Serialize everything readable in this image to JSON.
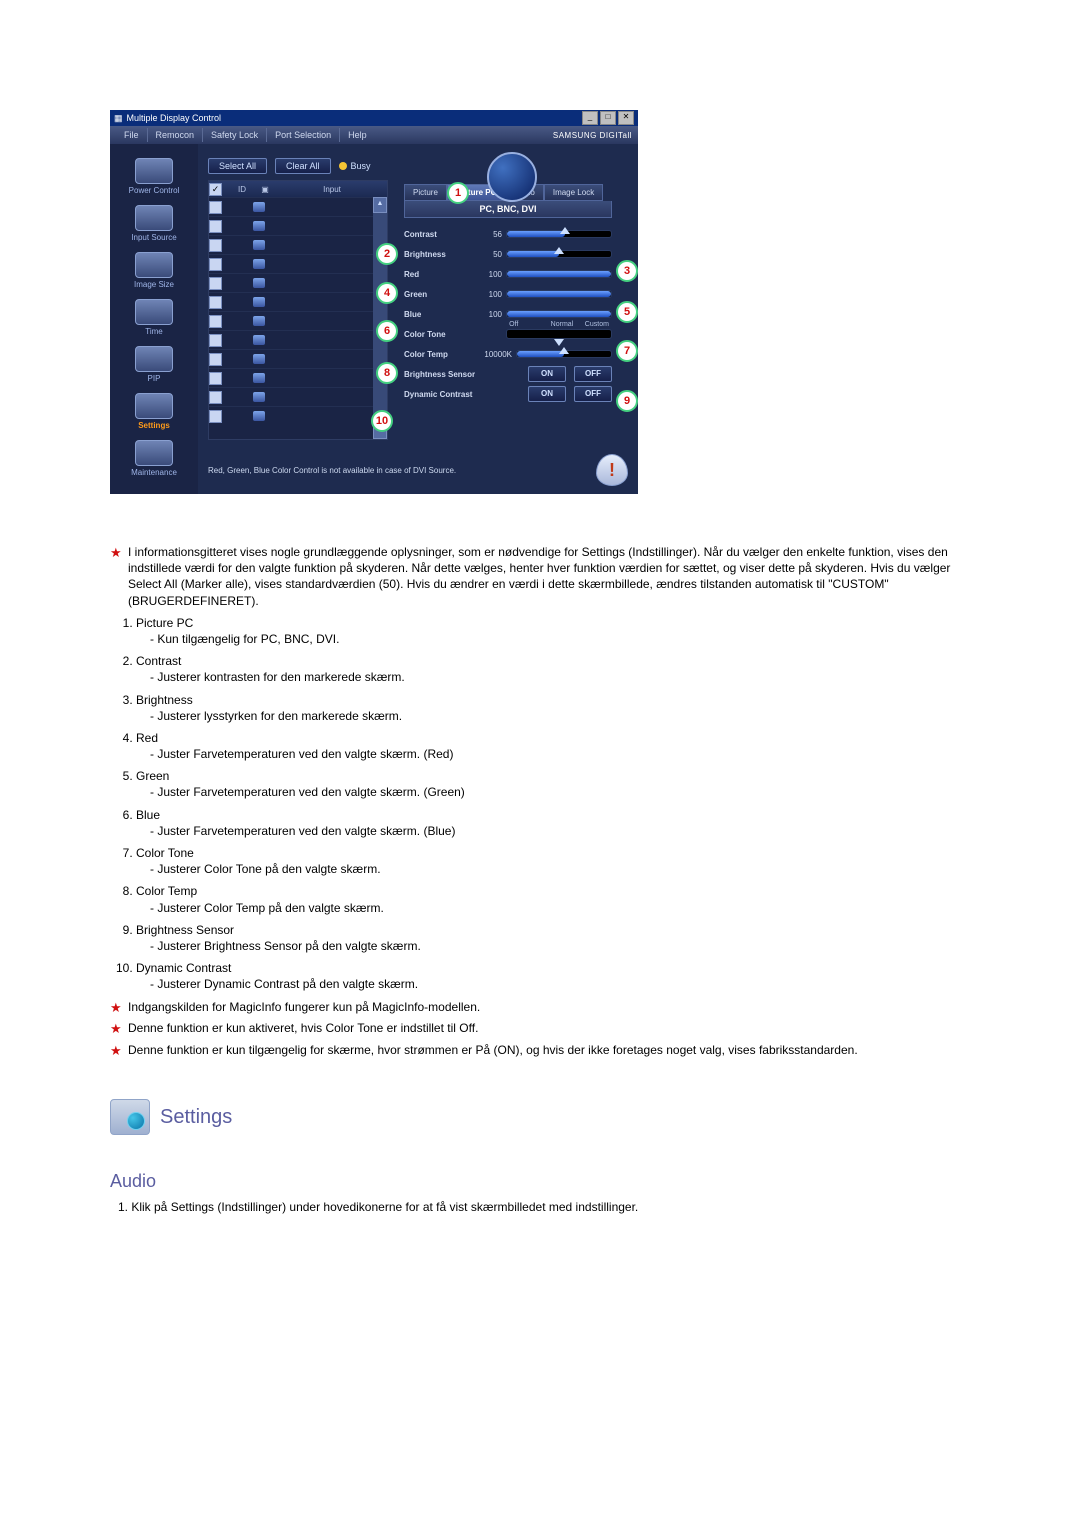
{
  "screenshot": {
    "titlebar": "Multiple Display Control",
    "menus": [
      "File",
      "Remocon",
      "Safety Lock",
      "Port Selection",
      "Help"
    ],
    "brand": "SAMSUNG DIGITall",
    "buttons": {
      "select_all": "Select All",
      "clear_all": "Clear All",
      "busy": "Busy"
    },
    "sidebar": [
      {
        "label": "Power Control"
      },
      {
        "label": "Input Source"
      },
      {
        "label": "Image Size"
      },
      {
        "label": "Time"
      },
      {
        "label": "PIP"
      },
      {
        "label": "Settings"
      },
      {
        "label": "Maintenance"
      }
    ],
    "left_panel": {
      "cols": [
        "",
        "ID",
        "",
        "Input"
      ]
    },
    "tabs": [
      "Picture",
      "Picture PC",
      "Audio",
      "Image Lock"
    ],
    "subheader": "PC, BNC, DVI",
    "controls": {
      "contrast": {
        "label": "Contrast",
        "value": "56"
      },
      "brightness": {
        "label": "Brightness",
        "value": "50"
      },
      "red": {
        "label": "Red",
        "value": "100"
      },
      "green": {
        "label": "Green",
        "value": "100"
      },
      "blue": {
        "label": "Blue",
        "value": "100"
      },
      "color_tone": {
        "label": "Color Tone",
        "opts": [
          "Off",
          "Normal",
          "Custom"
        ]
      },
      "color_temp": {
        "label": "Color Temp",
        "value": "10000K"
      },
      "brightness_sensor": {
        "label": "Brightness Sensor",
        "on": "ON",
        "off": "OFF"
      },
      "dynamic_contrast": {
        "label": "Dynamic Contrast",
        "on": "ON",
        "off": "OFF"
      }
    },
    "footer_note": "Red, Green, Blue Color Control is not available in case of DVI Source."
  },
  "callouts": [
    "1",
    "2",
    "3",
    "4",
    "5",
    "6",
    "7",
    "8",
    "9",
    "10"
  ],
  "notes": {
    "intro": "I informationsgitteret vises nogle grundlæggende oplysninger, som er nødvendige for Settings (Indstillinger). Når du vælger den enkelte funktion, vises den indstillede værdi for den valgte funktion på skyderen. Når dette vælges, henter hver funktion værdien for sættet, og viser dette på skyderen. Hvis du vælger Select All (Marker alle), vises standardværdien (50). Hvis du ændrer en værdi i dette skærmbillede, ændres tilstanden automatisk til \"CUSTOM\" (BRUGERDEFINERET).",
    "items": [
      {
        "h": "Picture PC",
        "d": "- Kun tilgængelig for PC, BNC, DVI."
      },
      {
        "h": "Contrast",
        "d": "- Justerer kontrasten for den markerede skærm."
      },
      {
        "h": "Brightness",
        "d": "- Justerer lysstyrken for den markerede skærm."
      },
      {
        "h": "Red",
        "d": "- Juster Farvetemperaturen ved den valgte skærm. (Red)"
      },
      {
        "h": "Green",
        "d": "- Juster Farvetemperaturen ved den valgte skærm. (Green)"
      },
      {
        "h": "Blue",
        "d": "- Juster Farvetemperaturen ved den valgte skærm. (Blue)"
      },
      {
        "h": "Color Tone",
        "d": "- Justerer Color Tone på den valgte skærm."
      },
      {
        "h": "Color Temp",
        "d": "- Justerer Color Temp på den valgte skærm."
      },
      {
        "h": "Brightness Sensor",
        "d": "- Justerer Brightness Sensor på den valgte skærm."
      },
      {
        "h": "Dynamic Contrast",
        "d": "- Justerer Dynamic Contrast på den valgte skærm."
      }
    ],
    "star1": "Indgangskilden for MagicInfo fungerer kun på MagicInfo-modellen.",
    "star2": "Denne funktion er kun aktiveret, hvis Color Tone er indstillet til Off.",
    "star3": "Denne funktion er kun tilgængelig for skærme, hvor strømmen er På (ON), og hvis der ikke foretages noget valg, vises fabriksstandarden."
  },
  "section": {
    "title": "Settings",
    "subtitle": "Audio",
    "line": "1. Klik på Settings (Indstillinger) under hovedikonerne for at få vist skærmbilledet med indstillinger."
  }
}
